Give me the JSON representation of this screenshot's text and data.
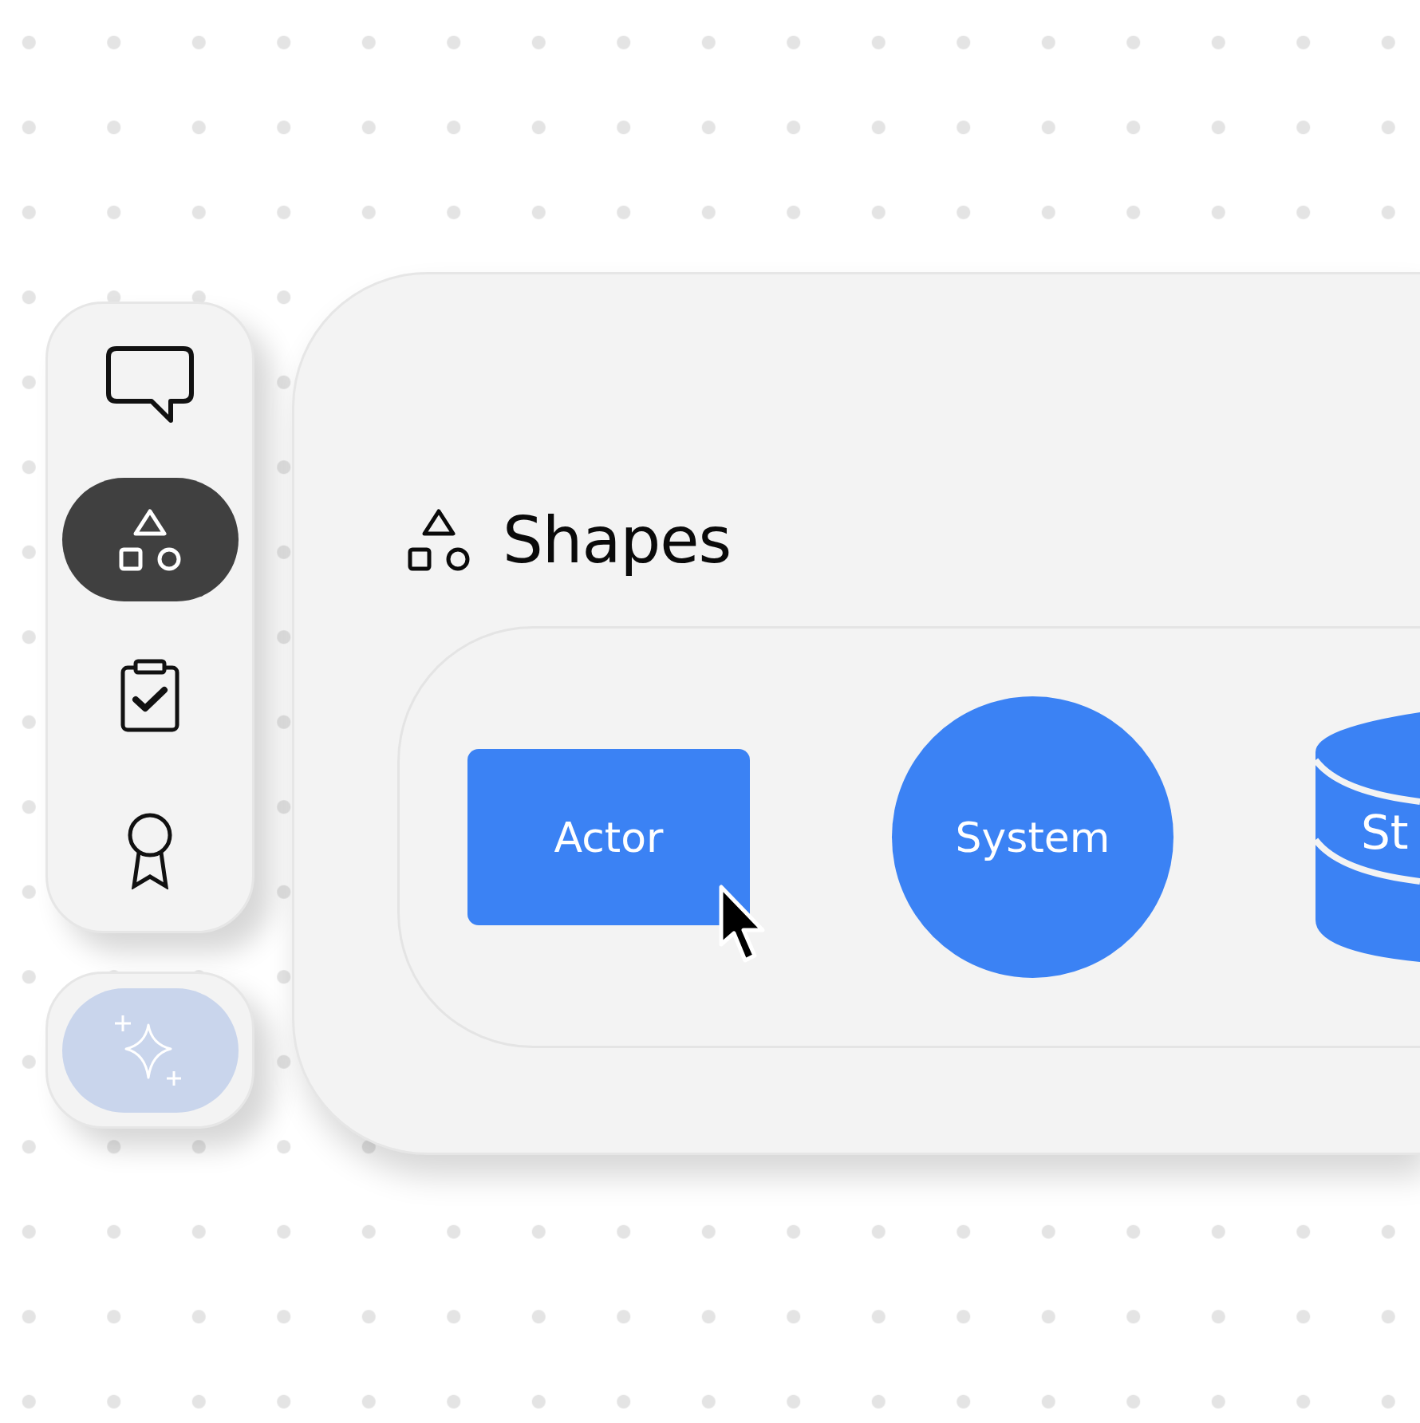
{
  "sidebar": {
    "items": [
      {
        "kind": "chat",
        "selected": false
      },
      {
        "kind": "shapes",
        "selected": true
      },
      {
        "kind": "clipboard",
        "selected": false
      },
      {
        "kind": "award",
        "selected": false
      }
    ],
    "assistant_button": {
      "kind": "sparkle"
    }
  },
  "panel": {
    "title": "Shapes",
    "shapes": [
      {
        "kind": "rectangle",
        "label": "Actor"
      },
      {
        "kind": "circle",
        "label": "System"
      },
      {
        "kind": "cylinder",
        "label": "St"
      }
    ]
  }
}
